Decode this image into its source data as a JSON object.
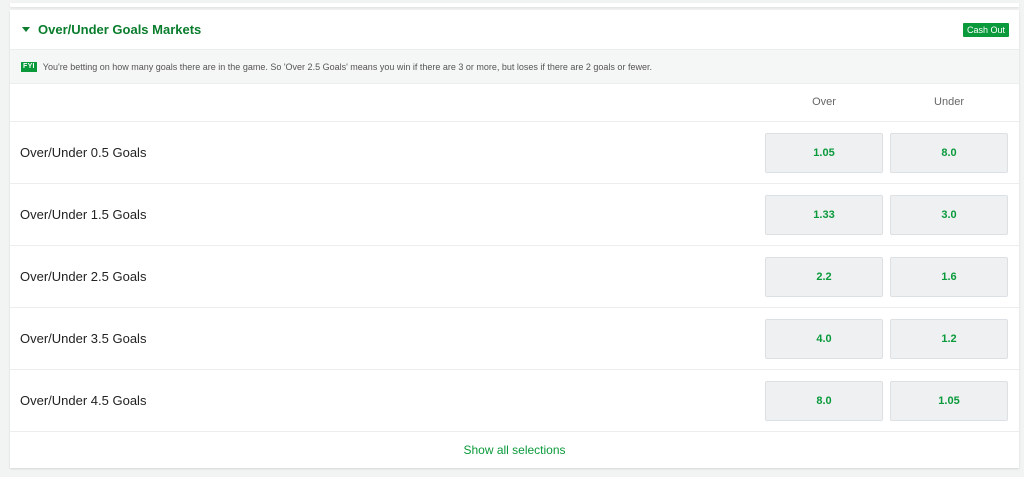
{
  "market": {
    "title": "Over/Under Goals Markets",
    "cash_out_label": "Cash Out",
    "fyi_badge": "FYI",
    "fyi_text": "You're betting on how many goals there are in the game. So 'Over 2.5 Goals' means you win if there are 3 or more, but loses if there are 2 goals or fewer.",
    "columns": {
      "over": "Over",
      "under": "Under"
    },
    "rows": [
      {
        "label": "Over/Under 0.5 Goals",
        "over": "1.05",
        "under": "8.0"
      },
      {
        "label": "Over/Under 1.5 Goals",
        "over": "1.33",
        "under": "3.0"
      },
      {
        "label": "Over/Under 2.5 Goals",
        "over": "2.2",
        "under": "1.6"
      },
      {
        "label": "Over/Under 3.5 Goals",
        "over": "4.0",
        "under": "1.2"
      },
      {
        "label": "Over/Under 4.5 Goals",
        "over": "8.0",
        "under": "1.05"
      }
    ],
    "show_all_label": "Show all selections"
  },
  "colors": {
    "accent": "#0a9a3b",
    "title": "#0a7d2d"
  }
}
